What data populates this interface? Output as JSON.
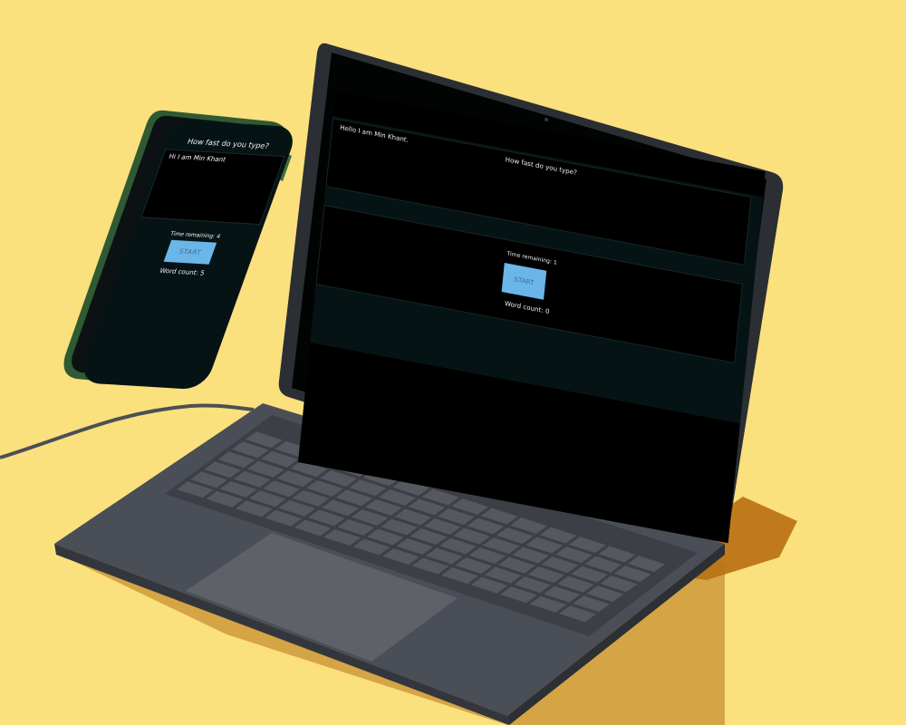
{
  "phone": {
    "title": "How fast do you type?",
    "textarea_value": "Hi I am Min Khant",
    "time_label": "Time remaining: 4",
    "start_label": "START",
    "word_count_label": "Word count: 5"
  },
  "laptop": {
    "title": "How fast do you type?",
    "textarea_value": "Hello I am Min Khant.",
    "time_label": "Time remaining: 1",
    "start_label": "START",
    "word_count_label": "Word count: 0"
  },
  "colors": {
    "background": "#fbe07e",
    "screen_bg": "#061315",
    "button_bg": "#6ab6e9",
    "phone_case": "#2f5a33",
    "laptop_body": "#4a4e56"
  }
}
